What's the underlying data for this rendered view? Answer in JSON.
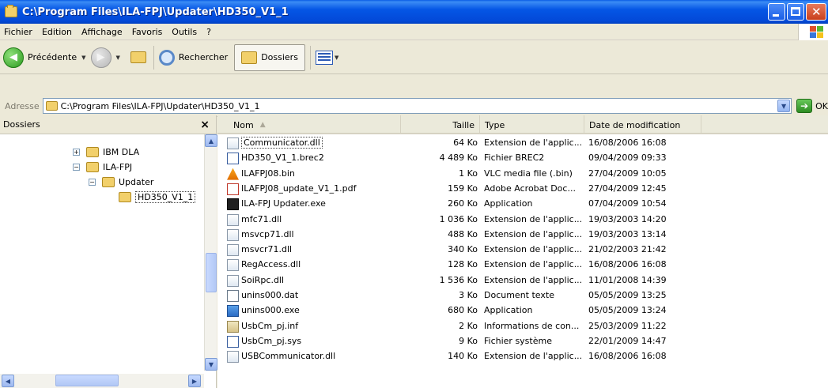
{
  "window": {
    "title": "C:\\Program Files\\ILA-FPJ\\Updater\\HD350_V1_1"
  },
  "menu": [
    "Fichier",
    "Edition",
    "Affichage",
    "Favoris",
    "Outils",
    "?"
  ],
  "toolbar": {
    "back_label": "Précédente",
    "search_label": "Rechercher",
    "folders_label": "Dossiers"
  },
  "address": {
    "label": "Adresse",
    "value": "C:\\Program Files\\ILA-FPJ\\Updater\\HD350_V1_1",
    "go_label": "OK"
  },
  "folders_pane": {
    "title": "Dossiers",
    "close": "×",
    "tree": [
      {
        "label": "IBM DLA",
        "expander": "+"
      },
      {
        "label": "ILA-FPJ",
        "expander": "−"
      },
      {
        "label": "Updater",
        "expander": "−"
      },
      {
        "label": "HD350_V1_1",
        "expander": ""
      }
    ]
  },
  "columns": {
    "name": "Nom",
    "size": "Taille",
    "type": "Type",
    "date": "Date de modification"
  },
  "files": [
    {
      "name": "Communicator.dll",
      "size": "64 Ko",
      "type": "Extension de l'applic...",
      "date": "16/08/2006 16:08",
      "icon": "dll-icon"
    },
    {
      "name": "HD350_V1_1.brec2",
      "size": "4 489 Ko",
      "type": "Fichier BREC2",
      "date": "09/04/2009 09:33",
      "icon": "generic-file-icon"
    },
    {
      "name": "ILAFPJ08.bin",
      "size": "1 Ko",
      "type": "VLC media file (.bin)",
      "date": "27/04/2009 10:05",
      "icon": "vlc-cone-icon"
    },
    {
      "name": "ILAFPJ08_update_V1_1.pdf",
      "size": "159 Ko",
      "type": "Adobe Acrobat Doc...",
      "date": "27/04/2009 12:45",
      "icon": "pdf-icon"
    },
    {
      "name": "ILA-FPJ Updater.exe",
      "size": "260 Ko",
      "type": "Application",
      "date": "07/04/2009 10:54",
      "icon": "fpj-app-icon"
    },
    {
      "name": "mfc71.dll",
      "size": "1 036 Ko",
      "type": "Extension de l'applic...",
      "date": "19/03/2003 14:20",
      "icon": "dll-icon"
    },
    {
      "name": "msvcp71.dll",
      "size": "488 Ko",
      "type": "Extension de l'applic...",
      "date": "19/03/2003 13:14",
      "icon": "dll-icon"
    },
    {
      "name": "msvcr71.dll",
      "size": "340 Ko",
      "type": "Extension de l'applic...",
      "date": "21/02/2003 21:42",
      "icon": "dll-icon"
    },
    {
      "name": "RegAccess.dll",
      "size": "128 Ko",
      "type": "Extension de l'applic...",
      "date": "16/08/2006 16:08",
      "icon": "dll-icon"
    },
    {
      "name": "SoiRpc.dll",
      "size": "1 536 Ko",
      "type": "Extension de l'applic...",
      "date": "11/01/2008 14:39",
      "icon": "dll-icon"
    },
    {
      "name": "unins000.dat",
      "size": "3 Ko",
      "type": "Document texte",
      "date": "05/05/2009 13:25",
      "icon": "text-file-icon"
    },
    {
      "name": "unins000.exe",
      "size": "680 Ko",
      "type": "Application",
      "date": "05/05/2009 13:24",
      "icon": "installer-icon"
    },
    {
      "name": "UsbCm_pj.inf",
      "size": "2 Ko",
      "type": "Informations de con...",
      "date": "25/03/2009 11:22",
      "icon": "inf-icon"
    },
    {
      "name": "UsbCm_pj.sys",
      "size": "9 Ko",
      "type": "Fichier système",
      "date": "22/01/2009 14:47",
      "icon": "sys-file-icon"
    },
    {
      "name": "USBCommunicator.dll",
      "size": "140 Ko",
      "type": "Extension de l'applic...",
      "date": "16/08/2006 16:08",
      "icon": "dll-icon"
    }
  ]
}
